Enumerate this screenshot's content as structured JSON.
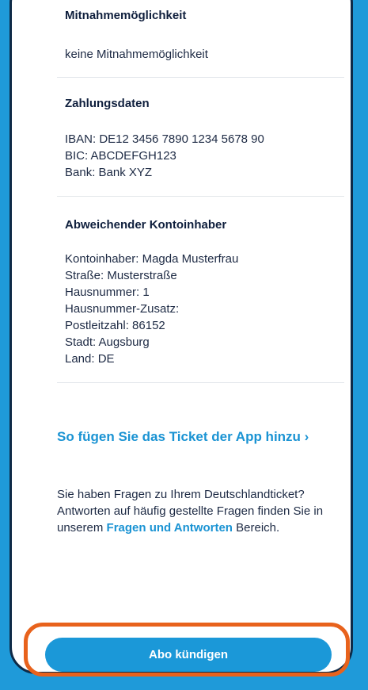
{
  "sections": {
    "mitnahme": {
      "title": "Mitnahmemöglichkeit",
      "value": "keine Mitnahmemöglichkeit"
    },
    "zahlung": {
      "title": "Zahlungsdaten",
      "lines": [
        "IBAN: DE12 3456 7890 1234 5678 90",
        "BIC: ABCDEFGH123",
        "Bank: Bank XYZ"
      ]
    },
    "kontoinhaber": {
      "title": "Abweichender Kontoinhaber",
      "lines": [
        "Kontoinhaber: Magda Musterfrau",
        "Straße: Musterstraße",
        "Hausnummer: 1",
        "Hausnummer-Zusatz:",
        "Postleitzahl: 86152",
        "Stadt: Augsburg",
        "Land: DE"
      ]
    }
  },
  "app_link": {
    "label": "So fügen Sie das Ticket der App hinzu",
    "chevron": "›"
  },
  "faq": {
    "text_before": "Sie haben Fragen zu Ihrem Deutschlandticket? Antworten auf häufig gestellte Fragen finden Sie in unserem ",
    "link_label": "Fragen und Antworten",
    "text_after": " Bereich."
  },
  "cancel_button": {
    "label": "Abo kündigen"
  },
  "colors": {
    "background": "#1f9ad9",
    "accent": "#1a93d3",
    "highlight": "#e8621c"
  }
}
